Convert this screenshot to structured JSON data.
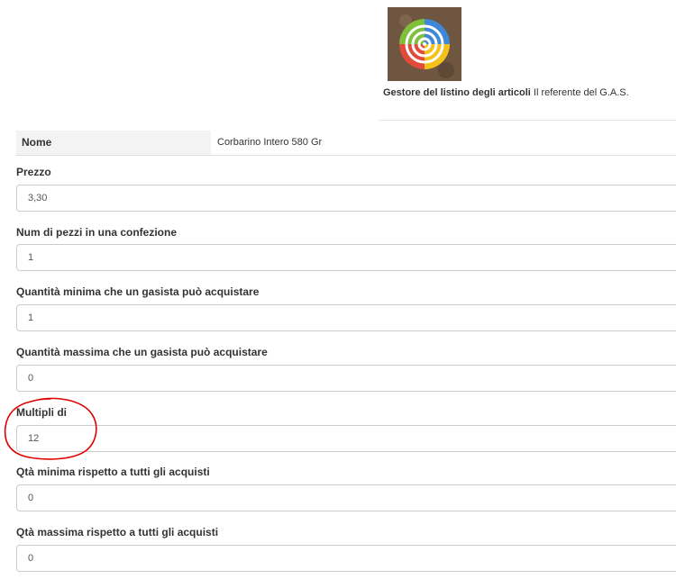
{
  "header": {
    "logo_icon": "gas-spiral-logo",
    "caption_bold": "Gestore del listino degli articoli",
    "caption_rest": " Il referente del G.A.S."
  },
  "name_row": {
    "label": "Nome",
    "value": "Corbarino Intero 580 Gr"
  },
  "fields": [
    {
      "label": "Prezzo",
      "value": "3,30"
    },
    {
      "label": "Num di pezzi in una confezione",
      "value": "1"
    },
    {
      "label": "Quantità minima che un gasista può acquistare",
      "value": "1"
    },
    {
      "label": "Quantità massima che un gasista può acquistare",
      "value": "0"
    },
    {
      "label": "Multipli di",
      "value": "12"
    },
    {
      "label": "Qtà minima rispetto a tutti gli acquisti",
      "value": "0"
    },
    {
      "label": "Qtà massima rispetto a tutti gli acquisti",
      "value": "0"
    }
  ],
  "annotation": {
    "color": "#e00000",
    "target": "Multipli di"
  }
}
